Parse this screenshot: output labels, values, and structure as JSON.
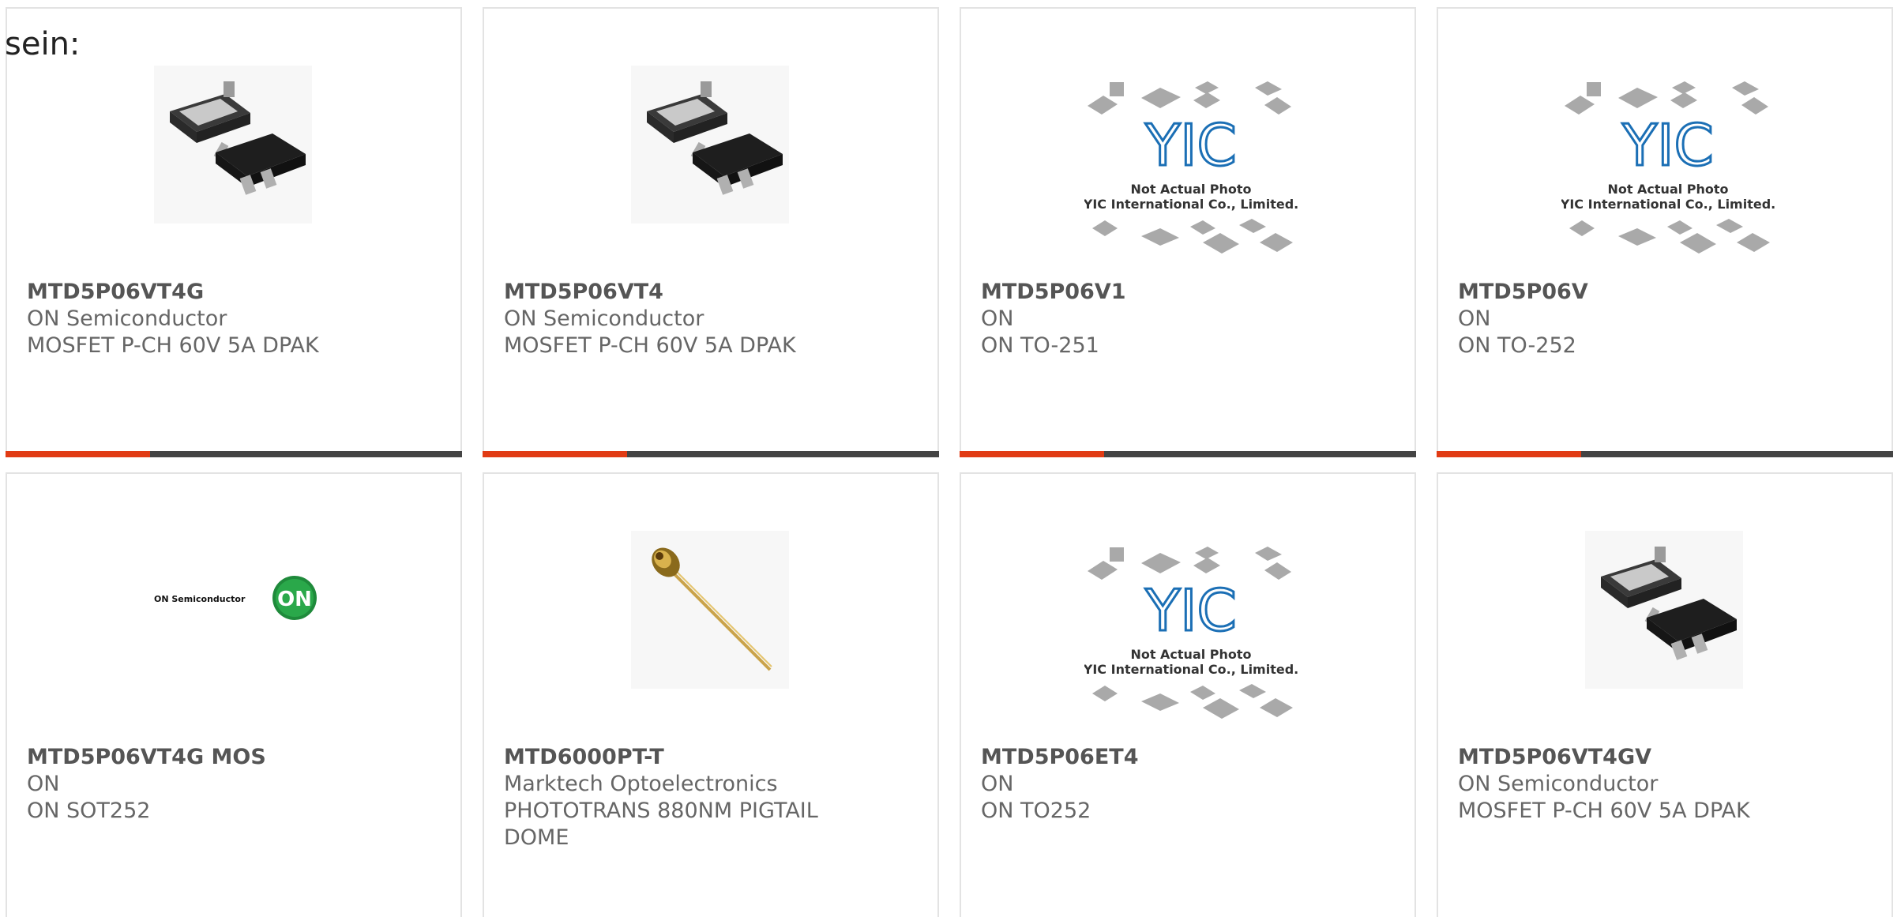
{
  "lead_text": "sein:",
  "colors": {
    "accent_bar": "#e13b14",
    "base_bar": "#444444",
    "card_border": "#e3e3e3",
    "text": "#666666"
  },
  "cards": [
    {
      "part_number": "MTD5P06VT4G",
      "manufacturer": "ON Semiconductor",
      "description": "MOSFET P-CH 60V 5A DPAK",
      "image": "dpak-package-photo"
    },
    {
      "part_number": "MTD5P06VT4",
      "manufacturer": "ON Semiconductor",
      "description": "MOSFET P-CH 60V 5A DPAK",
      "image": "dpak-package-photo"
    },
    {
      "part_number": "MTD5P06V1",
      "manufacturer": "ON",
      "description": "ON TO-251",
      "image": "yic-placeholder",
      "placeholder_text_1": "Not Actual Photo",
      "placeholder_text_2": "YIC International Co., Limited.",
      "placeholder_logo": "YIC"
    },
    {
      "part_number": "MTD5P06V",
      "manufacturer": "ON",
      "description": "ON TO-252",
      "image": "yic-placeholder",
      "placeholder_text_1": "Not Actual Photo",
      "placeholder_text_2": "YIC International Co., Limited.",
      "placeholder_logo": "YIC"
    },
    {
      "part_number": "MTD5P06VT4G MOS",
      "manufacturer": "ON",
      "description": "ON SOT252",
      "image": "on-semiconductor-logo",
      "logo_text": "ON Semiconductor",
      "logo_badge": "ON"
    },
    {
      "part_number": "MTD6000PT-T",
      "manufacturer": "Marktech Optoelectronics",
      "description": "PHOTOTRANS 880NM PIGTAIL DOME",
      "image": "phototransistor-photo"
    },
    {
      "part_number": "MTD5P06ET4",
      "manufacturer": "ON",
      "description": "ON TO252",
      "image": "yic-placeholder",
      "placeholder_text_1": "Not Actual Photo",
      "placeholder_text_2": "YIC International Co., Limited.",
      "placeholder_logo": "YIC"
    },
    {
      "part_number": "MTD5P06VT4GV",
      "manufacturer": "ON Semiconductor",
      "description": "MOSFET P-CH 60V 5A DPAK",
      "image": "dpak-package-photo"
    }
  ]
}
